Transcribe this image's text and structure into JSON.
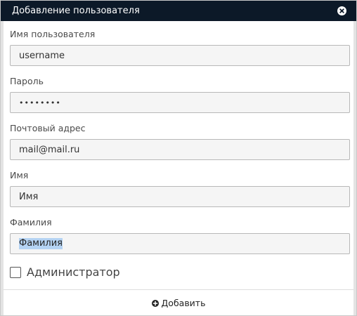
{
  "dialog": {
    "title": "Добавление пользователя",
    "close_icon": "close-circle-icon"
  },
  "form": {
    "username": {
      "label": "Имя пользователя",
      "value": "username"
    },
    "password": {
      "label": "Пароль",
      "value": "••••••••"
    },
    "email": {
      "label": "Почтовый адрес",
      "value": "mail@mail.ru"
    },
    "first_name": {
      "label": "Имя",
      "value": "Имя"
    },
    "last_name": {
      "label": "Фамилия",
      "value": "Фамилия"
    },
    "admin_checkbox": {
      "label": "Администратор",
      "checked": false
    }
  },
  "footer": {
    "add_label": "Добавить",
    "add_icon": "plus-circle-icon"
  },
  "colors": {
    "titlebar": "#0c1928",
    "selection": "#b5d3f3",
    "input_background": "#f5f5f5"
  }
}
